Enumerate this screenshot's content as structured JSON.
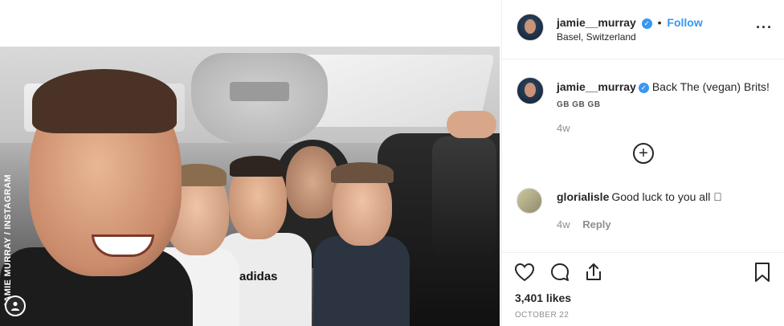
{
  "photo": {
    "watermark": "JAMIE MURRAY / INSTAGRAM",
    "shirt_brand": "adidas"
  },
  "post": {
    "author": "jamie__murray",
    "follow_label": "Follow",
    "location": "Basel, Switzerland",
    "more_icon": "more-options-icon",
    "more_glyph": "···"
  },
  "caption": {
    "author": "jamie__murray",
    "text": "Back The (vegan) Brits!",
    "flags": "GB GB GB",
    "time": "4w"
  },
  "load_more_glyph": "+",
  "comments": [
    {
      "author": "glorialisle",
      "text": "Good luck to you all",
      "emoji": "🏽",
      "time": "4w",
      "reply_label": "Reply"
    }
  ],
  "actions": {
    "likes": "3,401 likes",
    "date": "OCTOBER 22",
    "icons": [
      "heart-icon",
      "comment-icon",
      "share-icon",
      "bookmark-icon"
    ]
  },
  "colors": {
    "accent": "#3897f0",
    "text": "#262626",
    "muted": "#8e8e8e",
    "border": "#efefef"
  }
}
